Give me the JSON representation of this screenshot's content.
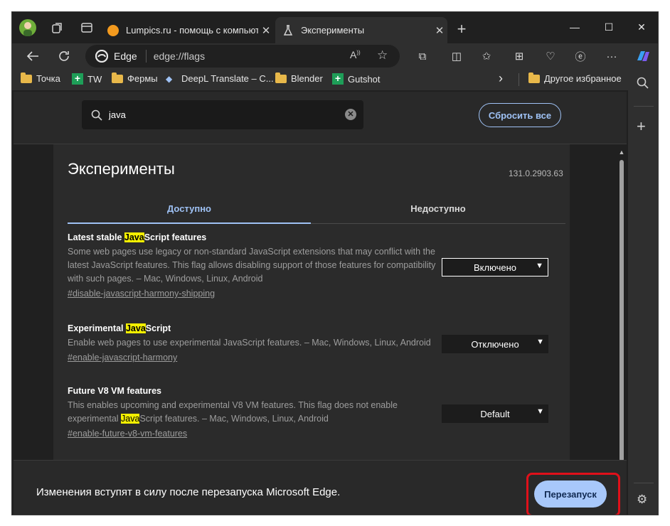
{
  "tabs": [
    {
      "title": "Lumpics.ru - помощь с компьюте",
      "close": "✕",
      "icon": "orange-favicon"
    },
    {
      "title": "Эксперименты",
      "close": "✕",
      "icon": "flask-favicon"
    }
  ],
  "new_tab": "+",
  "window_controls": {
    "minimize": "—",
    "maximize": "☐",
    "close": "✕"
  },
  "address": {
    "site_name": "Edge",
    "url": "edge://flags"
  },
  "favorites": [
    {
      "label": "Точка",
      "icon": "folder"
    },
    {
      "label": "TW",
      "icon": "plus-green"
    },
    {
      "label": "Фермы",
      "icon": "folder"
    },
    {
      "label": "DeepL Translate – C...",
      "icon": "deepl"
    },
    {
      "label": "Blender",
      "icon": "folder"
    },
    {
      "label": "Gutshot",
      "icon": "plus-green"
    }
  ],
  "favorites_more": "›",
  "favorites_other": "Другое избранное",
  "search": {
    "value": "java"
  },
  "reset_all": "Сбросить все",
  "page": {
    "title": "Эксперименты",
    "version": "131.0.2903.63"
  },
  "page_tabs": {
    "available": "Доступно",
    "unavailable": "Недоступно"
  },
  "flags": [
    {
      "name_pre": "Latest stable ",
      "name_hl": "Java",
      "name_post": "Script features",
      "desc": "Some web pages use legacy or non-standard JavaScript extensions that may conflict with the latest JavaScript features. This flag allows disabling support of those features for compatibility with such pages. – Mac, Windows, Linux, Android",
      "link": "#disable-javascript-harmony-shipping",
      "value": "Включено"
    },
    {
      "name_pre": "Experimental ",
      "name_hl": "Java",
      "name_post": "Script",
      "desc": "Enable web pages to use experimental JavaScript features. – Mac, Windows, Linux, Android",
      "link": "#enable-javascript-harmony",
      "value": "Отключено"
    },
    {
      "name": "Future V8 VM features",
      "desc_pre": "This enables upcoming and experimental V8 VM features. This flag does not enable experimental ",
      "desc_hl": "Java",
      "desc_post": "Script features. – Mac, Windows, Linux, Android",
      "link": "#enable-future-v8-vm-features",
      "value": "Default"
    }
  ],
  "footer": {
    "message": "Изменения вступят в силу после перезапуска Microsoft Edge.",
    "restart": "Перезапуск"
  },
  "colors": {
    "accent": "#9fc2f5",
    "highlight": "#f3ef00",
    "callout": "#e0101a"
  }
}
